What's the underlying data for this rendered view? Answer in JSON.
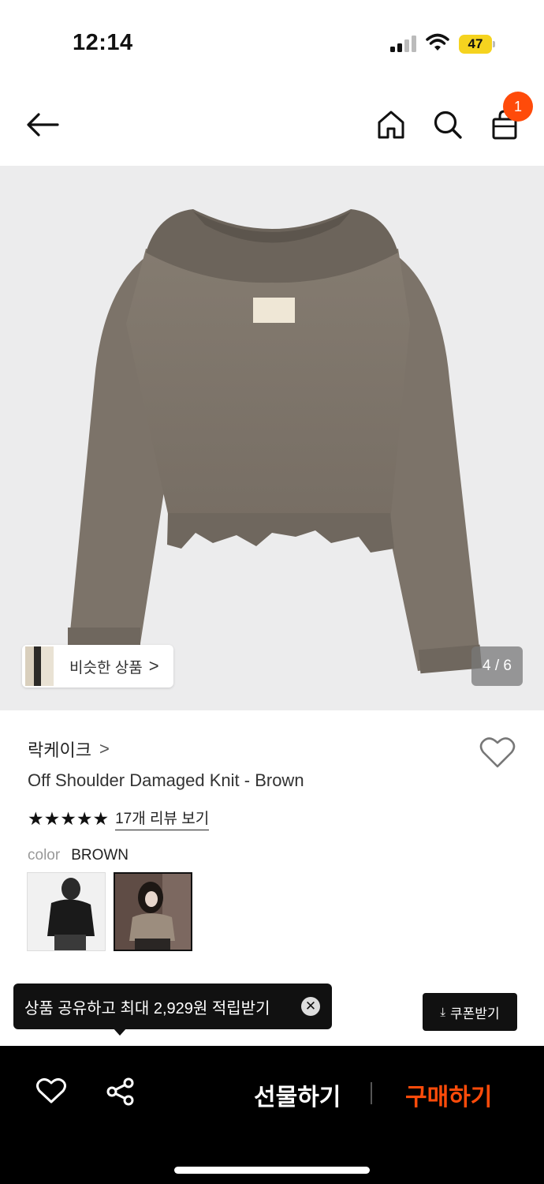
{
  "status_bar": {
    "time": "12:14",
    "battery": "47"
  },
  "nav": {
    "cart_badge": "1"
  },
  "gallery": {
    "similar_label": "비슷한 상품",
    "similar_chevron": ">",
    "page_indicator": "4 / 6"
  },
  "product": {
    "brand": "락케이크",
    "brand_chevron": ">",
    "title": "Off Shoulder Damaged Knit - Brown",
    "stars": "★★★★★",
    "review_link": "17개 리뷰 보기",
    "color_label": "color",
    "color_value": "BROWN"
  },
  "toast": {
    "message": "상품 공유하고 최대 2,929원 적립받기",
    "close": "✕"
  },
  "coupon": {
    "label": "쿠폰받기",
    "icon": "⤓"
  },
  "bottom_bar": {
    "gift_label": "선물하기",
    "buy_label": "구매하기"
  },
  "colors": {
    "accent": "#ff4b0a",
    "battery": "#f5d31f"
  }
}
